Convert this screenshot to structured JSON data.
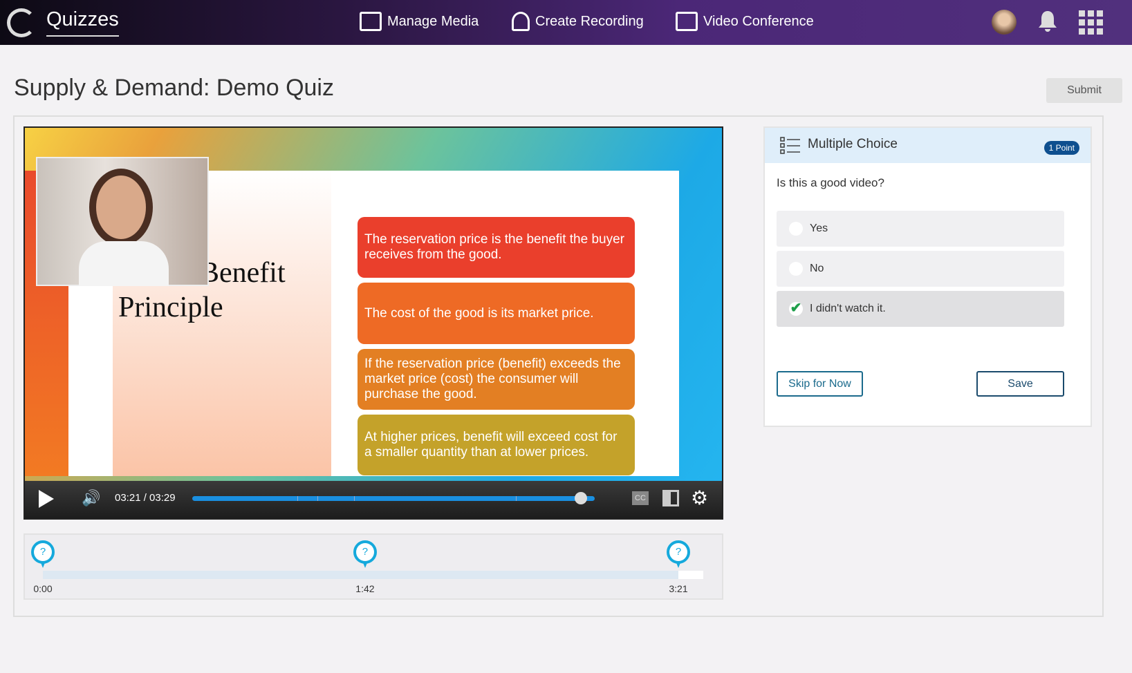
{
  "header": {
    "brand": "Quizzes",
    "nav": [
      {
        "label": "Manage Media",
        "icon": "media-icon"
      },
      {
        "label": "Create Recording",
        "icon": "recording-icon"
      },
      {
        "label": "Video Conference",
        "icon": "conference-icon"
      }
    ]
  },
  "page": {
    "title": "Supply & Demand: Demo Quiz",
    "submit": "Submit"
  },
  "video": {
    "slide_title_line1": "Benefit",
    "slide_title_line2": "Principle",
    "boxes": [
      {
        "text": "The reservation price is the benefit the buyer receives from the good.",
        "color": "#ea3f2c"
      },
      {
        "text": "The cost of the good is its market price.",
        "color": "#ee6a25"
      },
      {
        "text": "If the reservation price (benefit) exceeds the market price (cost) the consumer will purchase the good.",
        "color": "#e37f23"
      },
      {
        "text": "At higher prices, benefit will exceed cost for a smaller quantity than at lower prices.",
        "color": "#c4a22a"
      }
    ],
    "time": "03:21 / 03:29",
    "progress": 0.966,
    "cc": "CC"
  },
  "timeline": {
    "markers": [
      {
        "label": "0:00",
        "pos": 0
      },
      {
        "label": "1:42",
        "pos": 0.507
      },
      {
        "label": "3:21",
        "pos": 1.0
      }
    ]
  },
  "question": {
    "type": "Multiple Choice",
    "points": "1 Point",
    "text": "Is this a good video?",
    "options": [
      {
        "label": "Yes",
        "selected": false
      },
      {
        "label": "No",
        "selected": false
      },
      {
        "label": "I didn't watch it.",
        "selected": true
      }
    ],
    "skip": "Skip for Now",
    "save": "Save"
  }
}
